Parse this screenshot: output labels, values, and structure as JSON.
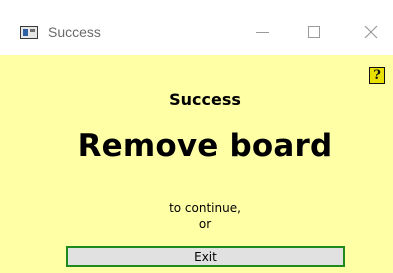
{
  "window": {
    "title": "Success"
  },
  "content": {
    "heading_small": "Success",
    "heading_large": "Remove board",
    "message_line1": "to continue,",
    "message_line2": "or"
  },
  "buttons": {
    "exit_label": "Exit",
    "help_glyph": "?"
  },
  "icons": {
    "app": "app-window-icon",
    "minimize": "minimize-icon",
    "maximize": "maximize-icon",
    "close": "close-icon",
    "help": "help-icon"
  },
  "colors": {
    "client_background": "#ffffa6",
    "exit_button_border": "#1e8a1e",
    "help_background": "#e8e000"
  }
}
